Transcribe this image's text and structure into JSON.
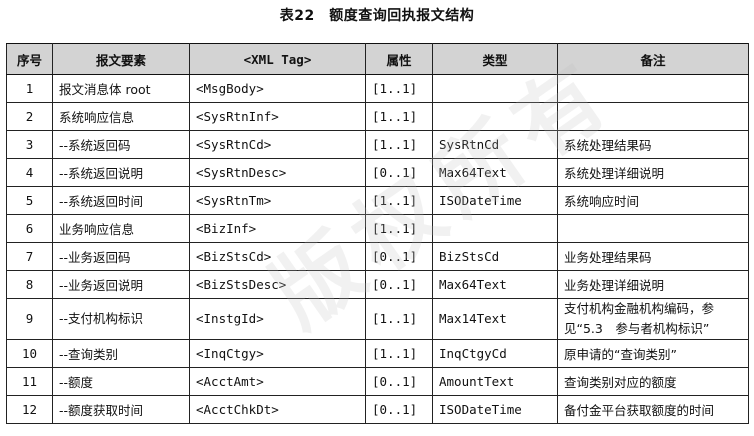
{
  "caption": "表22　额度查询回执报文结构",
  "headers": [
    "序号",
    "报文要素",
    "<XML Tag>",
    "属性",
    "类型",
    "备注"
  ],
  "rows": [
    {
      "no": "1",
      "element": "报文消息体 root",
      "tag": "<MsgBody>",
      "attr": "[1..1]",
      "type": "",
      "note": ""
    },
    {
      "no": "2",
      "element": "系统响应信息",
      "tag": "<SysRtnInf>",
      "attr": "[1..1]",
      "type": "",
      "note": ""
    },
    {
      "no": "3",
      "element": "--系统返回码",
      "tag": "<SysRtnCd>",
      "attr": "[1..1]",
      "type": "SysRtnCd",
      "note": "系统处理结果码"
    },
    {
      "no": "4",
      "element": "--系统返回说明",
      "tag": "<SysRtnDesc>",
      "attr": "[0..1]",
      "type": "Max64Text",
      "note": "系统处理详细说明"
    },
    {
      "no": "5",
      "element": "--系统返回时间",
      "tag": "<SysRtnTm>",
      "attr": "[1..1]",
      "type": "ISODateTime",
      "note": "系统响应时间"
    },
    {
      "no": "6",
      "element": "业务响应信息",
      "tag": "<BizInf>",
      "attr": "[1..1]",
      "type": "",
      "note": ""
    },
    {
      "no": "7",
      "element": "--业务返回码",
      "tag": "<BizStsCd>",
      "attr": "[0..1]",
      "type": "BizStsCd",
      "note": "业务处理结果码"
    },
    {
      "no": "8",
      "element": "--业务返回说明",
      "tag": "<BizStsDesc>",
      "attr": "[0..1]",
      "type": "Max64Text",
      "note": "业务处理详细说明"
    },
    {
      "no": "9",
      "element": "--支付机构标识",
      "tag": "<InstgId>",
      "attr": "[1..1]",
      "type": "Max14Text",
      "note": "支付机构金融机构编码，参见“5.3　参与者机构标识”"
    },
    {
      "no": "10",
      "element": "--查询类别",
      "tag": "<InqCtgy>",
      "attr": "[1..1]",
      "type": "InqCtgyCd",
      "note": "原申请的“查询类别”"
    },
    {
      "no": "11",
      "element": "--额度",
      "tag": "<AcctAmt>",
      "attr": "[0..1]",
      "type": "AmountText",
      "note": "查询类别对应的额度"
    },
    {
      "no": "12",
      "element": "--额度获取时间",
      "tag": "<AcctChkDt>",
      "attr": "[0..1]",
      "type": "ISODateTime",
      "note": "备付金平台获取额度的时间"
    }
  ],
  "watermark": "版权所有"
}
